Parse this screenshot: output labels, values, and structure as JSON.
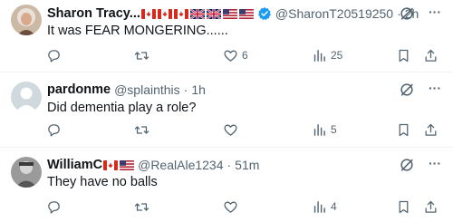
{
  "tweets": [
    {
      "name": "Sharon Tracy...",
      "flags": [
        "canada",
        "canada",
        "canada",
        "uk",
        "uk",
        "usa",
        "usa"
      ],
      "verified": true,
      "handle": "@SharonT20519250",
      "separator": "·",
      "time": "2h",
      "text": "It was FEAR MONGERING......",
      "replies": "",
      "retweets": "",
      "likes": "6",
      "views": "25"
    },
    {
      "name": "pardonme",
      "flags": [],
      "verified": false,
      "handle": "@splainthis",
      "separator": "·",
      "time": "1h",
      "text": "Did dementia play a role?",
      "replies": "",
      "retweets": "",
      "likes": "",
      "views": "5"
    },
    {
      "name": "WilliamC",
      "flags": [
        "canada",
        "usa"
      ],
      "verified": false,
      "handle": "@RealAle1234",
      "separator": "·",
      "time": "51m",
      "text": "They have no balls",
      "replies": "",
      "retweets": "",
      "likes": "",
      "views": "4"
    }
  ],
  "icons": {
    "reply": "reply-icon",
    "retweet": "retweet-icon",
    "like": "heart-icon",
    "views": "views-icon",
    "bookmark": "bookmark-icon",
    "share": "share-icon",
    "grok": "grok-icon",
    "more": "more-icon",
    "verified": "verified-badge-icon"
  },
  "colors": {
    "text": "#0f1419",
    "muted": "#536471",
    "verified": "#1d9bf0",
    "divider": "#eff3f4"
  }
}
